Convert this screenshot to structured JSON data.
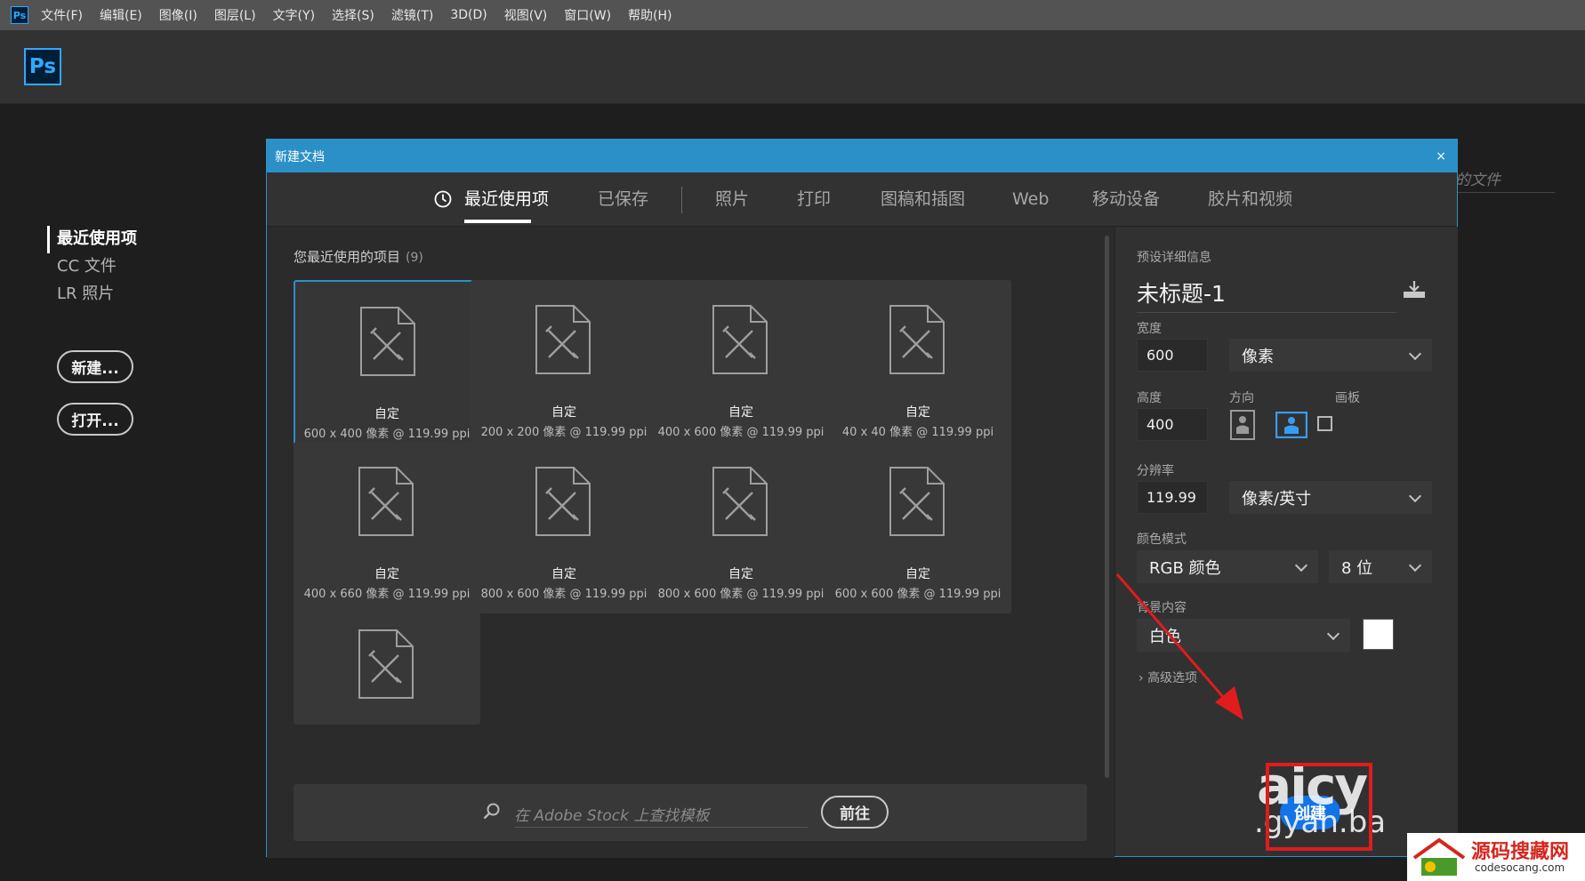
{
  "menubar": {
    "app_icon": "Ps",
    "items": [
      "文件(F)",
      "编辑(E)",
      "图像(I)",
      "图层(L)",
      "文字(Y)",
      "选择(S)",
      "滤镜(T)",
      "3D(D)",
      "视图(V)",
      "窗口(W)",
      "帮助(H)"
    ]
  },
  "topbar": {
    "logo": "Ps"
  },
  "start": {
    "nav": [
      "最近使用项",
      "CC 文件",
      "LR 照片"
    ],
    "new_button": "新建...",
    "open_button": "打开...",
    "bg_hint": "的文件"
  },
  "dialog": {
    "title": "新建文档",
    "close": "×",
    "tabs": [
      "最近使用项",
      "已保存",
      "照片",
      "打印",
      "图稿和插图",
      "Web",
      "移动设备",
      "胶片和视频"
    ],
    "recent_label": "您最近使用的项目",
    "recent_count": "(9)",
    "presets": [
      {
        "name": "自定",
        "dims": "600 x 400 像素 @ 119.99 ppi"
      },
      {
        "name": "自定",
        "dims": "200 x 200 像素 @ 119.99 ppi"
      },
      {
        "name": "自定",
        "dims": "400 x 600 像素 @ 119.99 ppi"
      },
      {
        "name": "自定",
        "dims": "40 x 40 像素 @ 119.99 ppi"
      },
      {
        "name": "自定",
        "dims": "400 x 660 像素 @ 119.99 ppi"
      },
      {
        "name": "自定",
        "dims": "800 x 600 像素 @ 119.99 ppi"
      },
      {
        "name": "自定",
        "dims": "800 x 600 像素 @ 119.99 ppi"
      },
      {
        "name": "自定",
        "dims": "600 x 600 像素 @ 119.99 ppi"
      },
      {
        "name": "",
        "dims": ""
      }
    ],
    "stock_placeholder": "在 Adobe Stock 上查找模板",
    "go_button": "前往",
    "details": {
      "header": "预设详细信息",
      "doc_name": "未标题-1",
      "width_label": "宽度",
      "width_value": "600",
      "width_unit": "像素",
      "height_label": "高度",
      "height_value": "400",
      "orientation_label": "方向",
      "artboard_label": "画板",
      "resolution_label": "分辨率",
      "resolution_value": "119.99",
      "resolution_unit": "像素/英寸",
      "color_mode_label": "颜色模式",
      "color_mode": "RGB 颜色",
      "bit_depth": "8 位",
      "bg_label": "背景内容",
      "bg_value": "白色",
      "bg_color": "#ffffff",
      "advanced": "高级选项",
      "create_button": "创建"
    }
  },
  "watermarks": {
    "aicy": "aicy",
    "gyan": ".gyan.ba",
    "source_cn": "源码搜藏网",
    "source_url": "codesocang.com"
  },
  "colors": {
    "accent": "#2c90c8",
    "primary_button": "#1473e6",
    "highlight_box": "#e01c1c"
  },
  "icons": {
    "clock": "clock-icon",
    "document": "document-icon",
    "save": "save-preset-icon",
    "search": "search-icon",
    "portrait": "portrait-icon",
    "landscape": "landscape-icon"
  }
}
